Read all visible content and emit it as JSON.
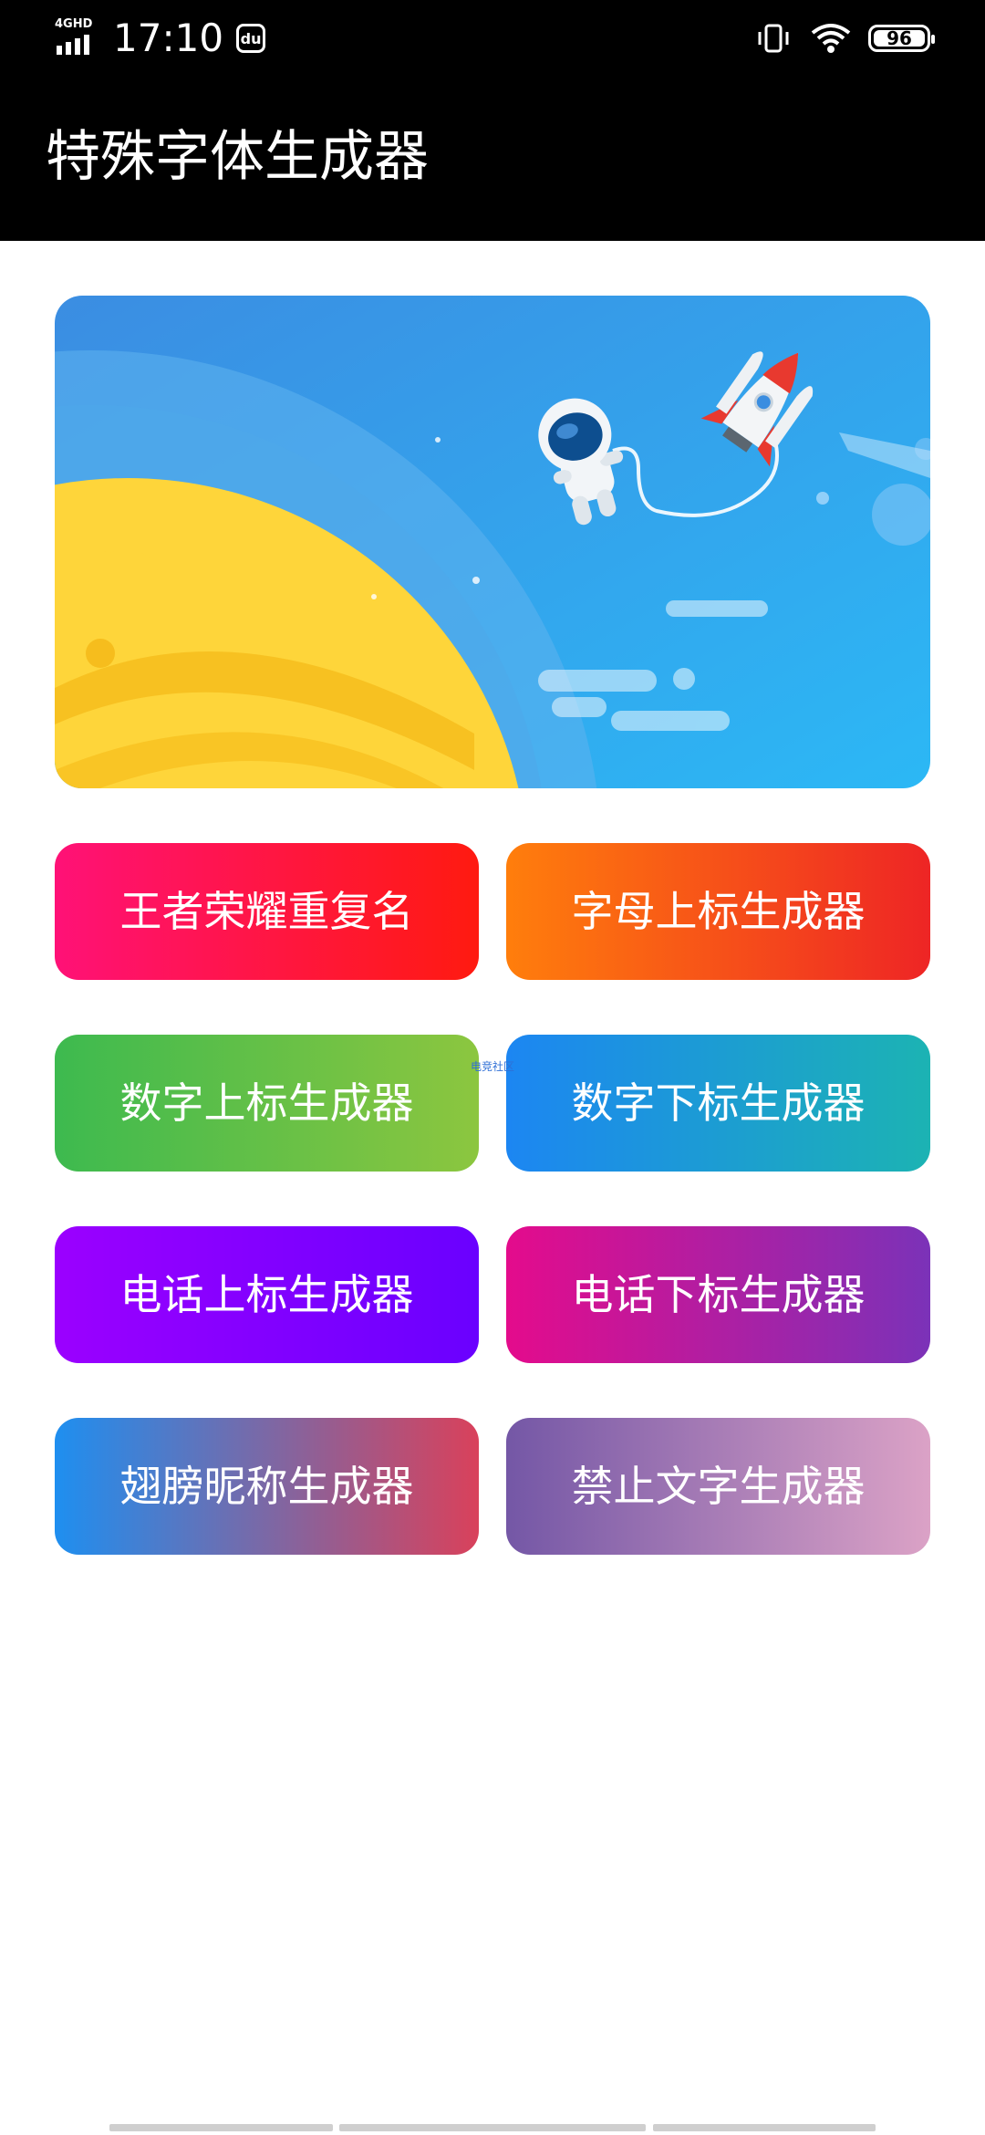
{
  "status_bar": {
    "network": "4GHD",
    "time": "17:10",
    "search_badge": "du",
    "battery_level": "96",
    "icons": [
      "signal-icon",
      "search-badge-icon",
      "vibrate-icon",
      "wifi-icon",
      "battery-icon"
    ]
  },
  "app_bar": {
    "title": "特殊字体生成器"
  },
  "banner": {
    "scene": [
      "planet-illustration",
      "astronaut-illustration",
      "rocket-illustration",
      "cloud-illustration"
    ]
  },
  "tiles": [
    {
      "label": "王者荣耀重复名",
      "colors": [
        "#ff1177",
        "#ff1a10"
      ]
    },
    {
      "label": "字母上标生成器",
      "colors": [
        "#ff7e0c",
        "#ee2525"
      ]
    },
    {
      "label": "数字上标生成器",
      "colors": [
        "#3dba4f",
        "#8cc63f"
      ]
    },
    {
      "label": "数字下标生成器",
      "colors": [
        "#1c86f2",
        "#1cb3b3"
      ]
    },
    {
      "label": "电话上标生成器",
      "colors": [
        "#9b00ff",
        "#6a00ff"
      ]
    },
    {
      "label": "电话下标生成器",
      "colors": [
        "#e40b8c",
        "#7b32b8"
      ]
    },
    {
      "label": "翅膀昵称生成器",
      "colors": [
        "#1e8ff0",
        "#d9415b"
      ]
    },
    {
      "label": "禁止文字生成器",
      "colors": [
        "#7457a6",
        "#dba2c6"
      ]
    }
  ],
  "watermark": "电竞社区"
}
